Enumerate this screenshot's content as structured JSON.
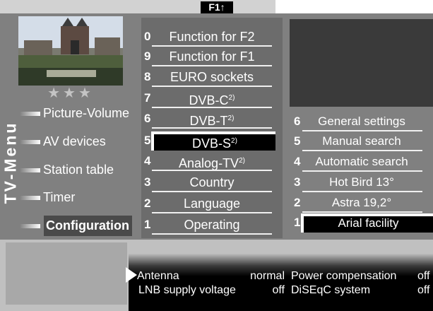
{
  "header": {
    "key_label": "F1"
  },
  "sidebar": {
    "title": "TV-Menu",
    "rating_stars": "★★★",
    "items": [
      {
        "label": "Picture-Volume"
      },
      {
        "label": "AV devices"
      },
      {
        "label": "Station table"
      },
      {
        "label": "Timer"
      },
      {
        "label": "Configuration",
        "selected": true
      }
    ]
  },
  "config_menu": {
    "items": [
      {
        "num": "0",
        "label": "Function for F2"
      },
      {
        "num": "9",
        "label": "Function for F1"
      },
      {
        "num": "8",
        "label": "EURO sockets"
      },
      {
        "num": "7",
        "label": "DVB-C",
        "sup": "2)"
      },
      {
        "num": "6",
        "label": "DVB-T",
        "sup": "2)"
      },
      {
        "num": "5",
        "label": "DVB-S",
        "sup": "2)",
        "selected": true
      },
      {
        "num": "4",
        "label": "Analog-TV",
        "sup": "2)"
      },
      {
        "num": "3",
        "label": "Country"
      },
      {
        "num": "2",
        "label": "Language"
      },
      {
        "num": "1",
        "label": "Operating"
      }
    ]
  },
  "dvbs_menu": {
    "items": [
      {
        "num": "6",
        "label": "General settings"
      },
      {
        "num": "5",
        "label": "Manual search"
      },
      {
        "num": "4",
        "label": "Automatic search"
      },
      {
        "num": "3",
        "label": "Hot Bird 13°"
      },
      {
        "num": "2",
        "label": "Astra 19,2°"
      },
      {
        "num": "1",
        "label": "Arial facility",
        "selected": true
      }
    ]
  },
  "info": {
    "antenna_label": "Antenna",
    "antenna_value": "normal",
    "power_label": "Power compensation",
    "power_value": "off",
    "lnb_label": "LNB supply voltage",
    "lnb_value": "off",
    "diseqc_label": "DiSEqC system",
    "diseqc_value": "off"
  }
}
